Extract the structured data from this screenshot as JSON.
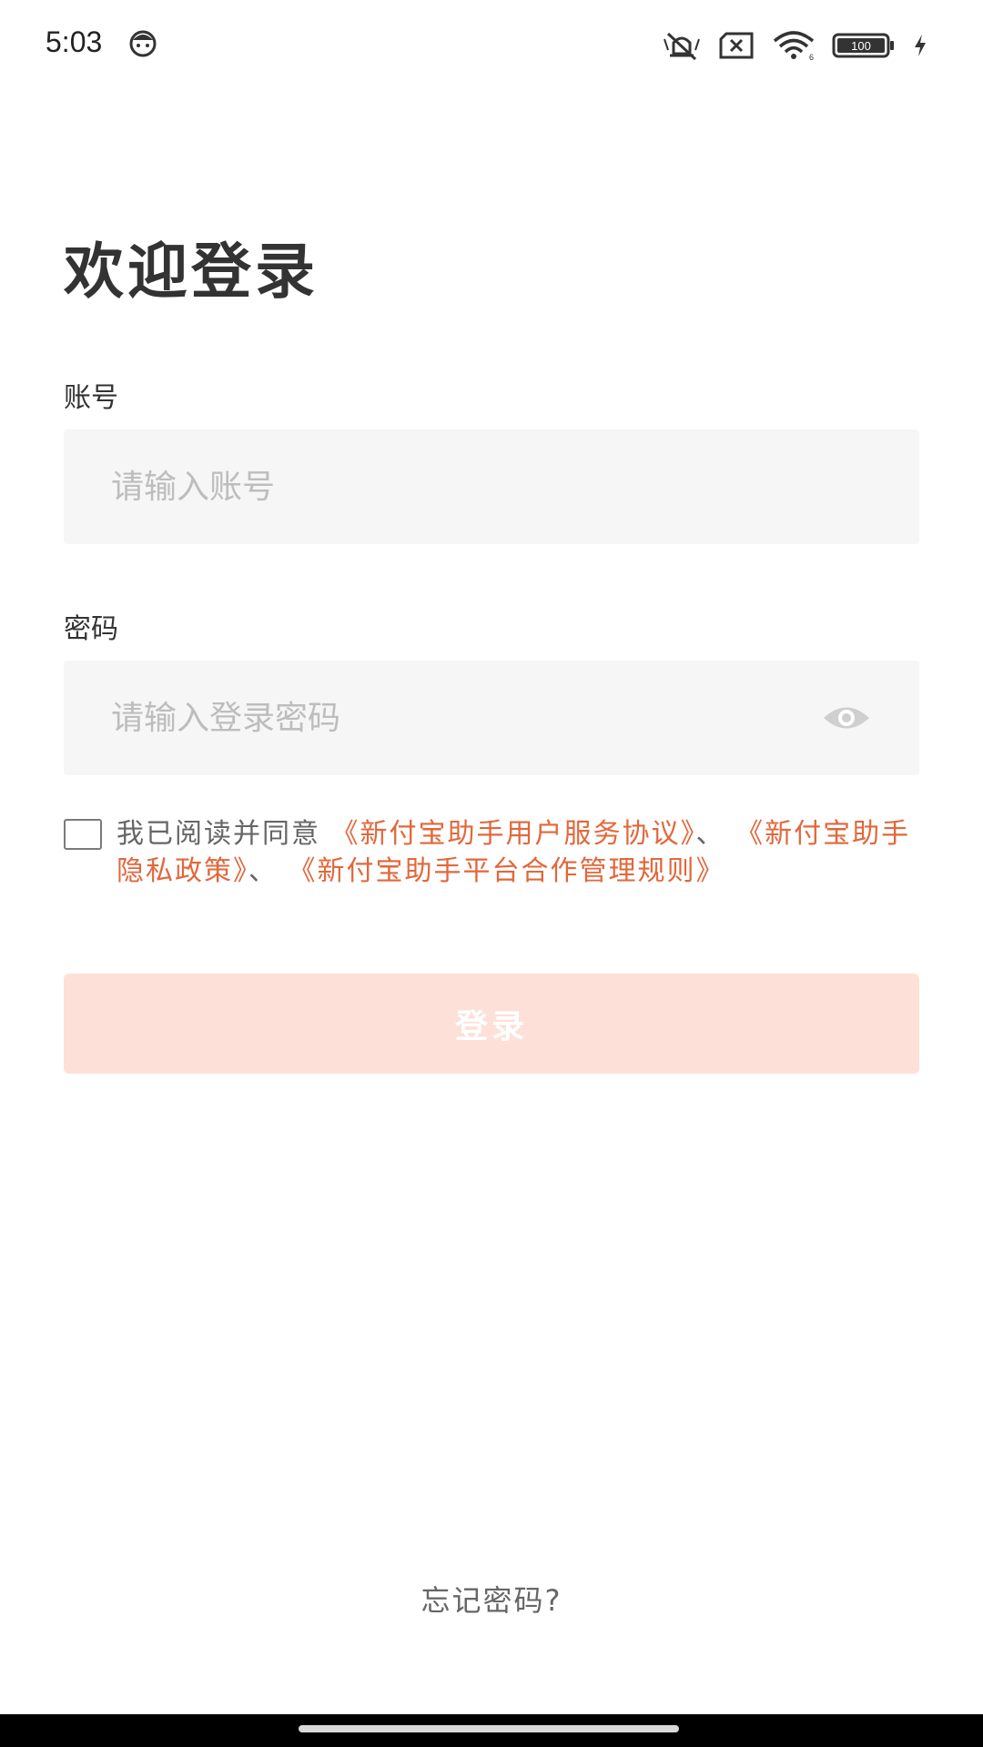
{
  "status_bar": {
    "time": "5:03",
    "battery_text": "100",
    "wifi_text": "6"
  },
  "page": {
    "title": "欢迎登录"
  },
  "account": {
    "label": "账号",
    "placeholder": "请输入账号",
    "value": ""
  },
  "password": {
    "label": "密码",
    "placeholder": "请输入登录密码",
    "value": ""
  },
  "agreement": {
    "checked": false,
    "prefix": "我已阅读并同意",
    "link1": "《新付宝助手用户服务协议》",
    "sep1": "、",
    "link2": "《新付宝助手隐私政策》",
    "sep2": "、",
    "link3": "《新付宝助手平台合作管理规则》"
  },
  "login_button": {
    "label": "登录"
  },
  "forgot_password": {
    "label": "忘记密码?"
  },
  "colors": {
    "accent": "#e2673b",
    "button_disabled_bg": "#fde0d7",
    "input_bg": "#f6f6f6"
  },
  "icons": {
    "status_app": "face-icon",
    "mute": "vibrate-off-icon",
    "sim": "no-sim-icon",
    "wifi": "wifi-icon",
    "battery": "battery-icon",
    "charging": "charging-icon",
    "password_toggle": "eye-icon"
  }
}
